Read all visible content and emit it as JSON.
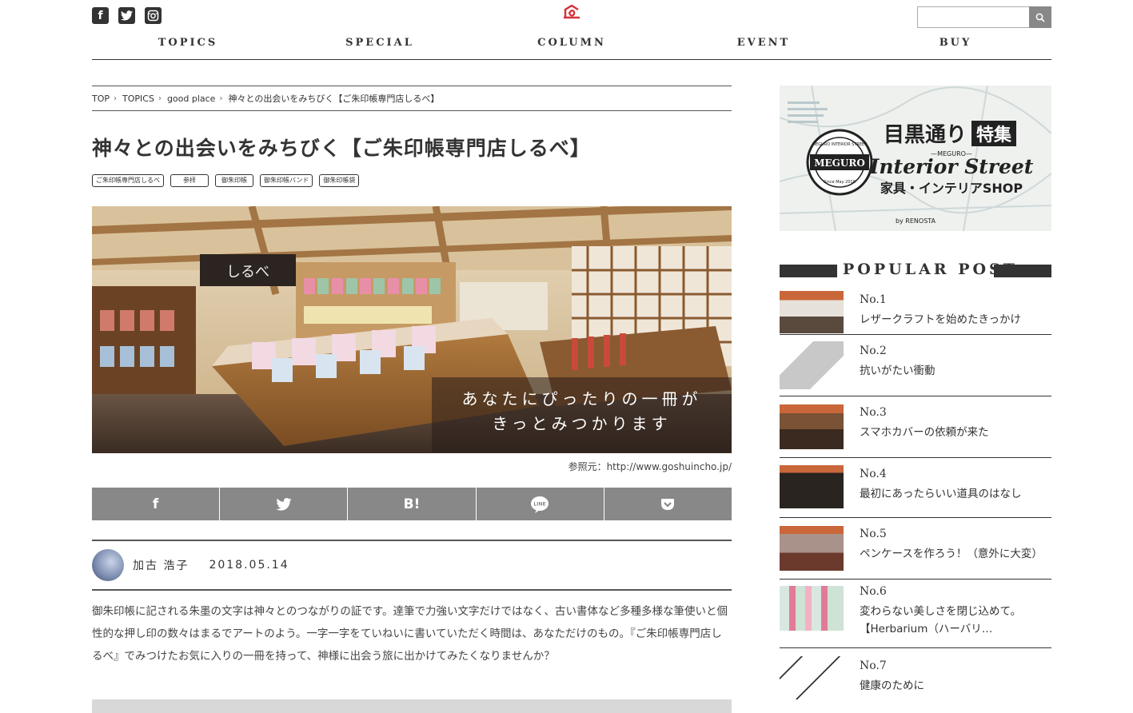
{
  "header": {
    "social": [
      "facebook-icon",
      "twitter-icon",
      "instagram-icon"
    ],
    "search_placeholder": "",
    "nav": [
      "TOPICS",
      "SPECIAL",
      "COLUMN",
      "EVENT",
      "BUY"
    ]
  },
  "breadcrumb": [
    "TOP",
    "TOPICS",
    "good place",
    "神々との出会いをみちびく【ご朱印帳専門店しるべ】"
  ],
  "article": {
    "title": "神々との出会いをみちびく【ご朱印帳専門店しるべ】",
    "tags": [
      "ご朱印帳専門店しるべ",
      "参拝",
      "御朱印帳",
      "御朱印帳バンド",
      "御朱印帳袋"
    ],
    "hero_caption_line1": "あなたにぴったりの一冊が",
    "hero_caption_line2": "きっとみつかります",
    "hero_sign": "しるべ",
    "source": "参照元：http://www.goshuincho.jp/",
    "share": [
      {
        "icon": "facebook-icon",
        "label": "f"
      },
      {
        "icon": "twitter-icon",
        "label": ""
      },
      {
        "icon": "hatena-bookmark-icon",
        "label": "B!"
      },
      {
        "icon": "line-icon",
        "label": "LINE"
      },
      {
        "icon": "pocket-icon",
        "label": ""
      }
    ],
    "author": "加古 浩子",
    "date": "2018.05.14",
    "intro": "御朱印帳に記される朱墨の文字は神々とのつながりの証です。達筆で力強い文字だけではなく、古い書体など多種多様な筆使いと個性的な押し印の数々はまるでアートのよう。一字一字をていねいに書いていただく時間は、あなただけのもの。『ご朱印帳専門店しるべ』でみつけたお気に入りの一冊を持って、神様に出会う旅に出かけてみたくなりませんか？"
  },
  "sidebar": {
    "banner": {
      "line1": "目黒通り",
      "badge": "特集",
      "sub": "—MEGURO—",
      "script": "Interior Street",
      "line3": "家具・インテリアSHOP",
      "by": "by RENOSTA",
      "seal_top": "MEGURO INTERIOR STREET",
      "seal_center": "MEGURO",
      "seal_bottom": "Since May 2018"
    },
    "popular_title": "POPULAR POST",
    "posts": [
      {
        "num": "No.1",
        "title": "レザークラフトを始めたきっかけ"
      },
      {
        "num": "No.2",
        "title": "抗いがたい衝動"
      },
      {
        "num": "No.3",
        "title": "スマホカバーの依頼が来た"
      },
      {
        "num": "No.4",
        "title": "最初にあったらいい道具のはなし"
      },
      {
        "num": "No.5",
        "title": "ペンケースを作ろう！（意外に大変）"
      },
      {
        "num": "No.6",
        "title": "変わらない美しさを閉じ込めて。【Herbarium（ハーバリ…"
      },
      {
        "num": "No.7",
        "title": "健康のために"
      }
    ]
  }
}
